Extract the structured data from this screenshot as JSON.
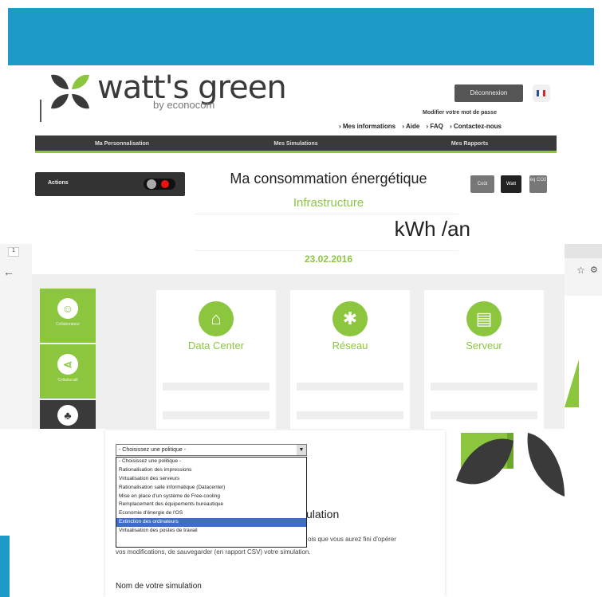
{
  "header": {
    "logo_main": "watt's green",
    "logo_sub": "by econocom",
    "logout_label": "Déconnexion",
    "change_password": "Modifier votre mot de passe",
    "user_links": [
      "› Mes informations",
      "› Aide",
      "› FAQ",
      "› Contactez-nous"
    ]
  },
  "nav": {
    "items": [
      "Ma Personnalisation",
      "Mes Simulations",
      "Mes Rapports"
    ]
  },
  "actions": {
    "label": "Actions"
  },
  "main": {
    "title": "Ma consommation énergétique",
    "subtitle": "Infrastructure",
    "unit": "kWh /an",
    "date": "23.02.2016"
  },
  "view_toggle": {
    "cout": "Coût",
    "watt": "Watt",
    "co2": "éq CO2"
  },
  "side_nav": {
    "items": [
      {
        "label": "Collaborateur",
        "icon": "person-icon"
      },
      {
        "label": "Collaboratif",
        "icon": "share-icon"
      },
      {
        "label": "",
        "icon": "sitemap-icon"
      }
    ]
  },
  "cards": [
    {
      "label": "Data Center",
      "icon": "home-icon"
    },
    {
      "label": "Réseau",
      "icon": "network-icon"
    },
    {
      "label": "Serveur",
      "icon": "server-icon"
    }
  ],
  "browser": {
    "tab_button": "1",
    "back": "←",
    "star": "☆",
    "settings": "⚙"
  },
  "dialog": {
    "select_value": "- Choisissez une politique -",
    "options": [
      "- Choisissez une politique -",
      "Rationalisation des impressions",
      "Virtualisation des serveurs",
      "Rationalisation salle informatique (Datacenter)",
      "Mise en place d'un système de Free-cooling",
      "Remplacement des équipements bureautique",
      "Economie d'énergie de l'OS",
      "Extinction des ordinateurs",
      "Virtualisation des postes de travail"
    ],
    "selected_index": 7,
    "sim_title": "ulation",
    "text_line1": "ois que vous aurez fini d'opérer",
    "text_line2": "vos modifications, de sauvegarder (en rapport CSV) votre simulation.",
    "name_label": "Nom de votre simulation"
  },
  "colors": {
    "accent_blue": "#1e9ac8",
    "green": "#8cc63f",
    "dark": "#3a3a3a"
  }
}
